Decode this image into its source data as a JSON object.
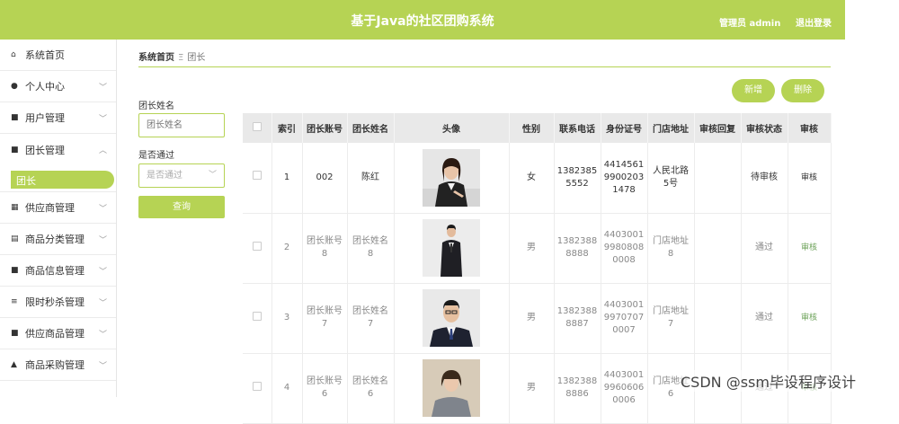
{
  "header": {
    "title": "基于Java的社区团购系统",
    "admin": "管理员 admin",
    "logout": "退出登录"
  },
  "sidebar": {
    "items": [
      {
        "label": "系统首页",
        "icon": "home-icon",
        "glyph": "▲"
      },
      {
        "label": "个人中心",
        "icon": "user-icon",
        "glyph": "●"
      },
      {
        "label": "用户管理",
        "icon": "grid-icon",
        "glyph": "■"
      },
      {
        "label": "团长管理",
        "icon": "grid-icon",
        "glyph": "■"
      },
      {
        "label": "供应商管理",
        "icon": "grid-icon",
        "glyph": "▦"
      },
      {
        "label": "商品分类管理",
        "icon": "clipboard-icon",
        "glyph": "▤"
      },
      {
        "label": "商品信息管理",
        "icon": "grid-icon",
        "glyph": "■"
      },
      {
        "label": "限时秒杀管理",
        "icon": "list-icon",
        "glyph": "≡"
      },
      {
        "label": "供应商品管理",
        "icon": "grid-icon",
        "glyph": "■"
      },
      {
        "label": "商品采购管理",
        "icon": "user-icon",
        "glyph": "▲"
      }
    ],
    "sub_active": "团长"
  },
  "breadcrumb": {
    "home": "系统首页",
    "sep": "Ξ",
    "current": "团长"
  },
  "search": {
    "name_label": "团长姓名",
    "name_placeholder": "团长姓名",
    "pass_label": "是否通过",
    "pass_value": "是否通过",
    "query_button": "查询"
  },
  "actions": {
    "add": "新增",
    "delete": "删除"
  },
  "table": {
    "headers": [
      "",
      "索引",
      "团长账号",
      "团长姓名",
      "头像",
      "性别",
      "联系电话",
      "身份证号",
      "门店地址",
      "审核回复",
      "审核状态",
      "审核"
    ],
    "rows": [
      {
        "index": "1",
        "account": "002",
        "name": "陈红",
        "gender": "女",
        "phone": "13823855552",
        "idcard": "441456199002031478",
        "address": "人民北路5号",
        "reply": "",
        "status": "待审核",
        "action": "审核"
      },
      {
        "index": "2",
        "account": "团长账号8",
        "name": "团长姓名8",
        "gender": "男",
        "phone": "13823888888",
        "idcard": "440300199808080008",
        "address": "门店地址8",
        "reply": "",
        "status": "通过",
        "action": "审核"
      },
      {
        "index": "3",
        "account": "团长账号7",
        "name": "团长姓名7",
        "gender": "男",
        "phone": "13823888887",
        "idcard": "440300199707070007",
        "address": "门店地址7",
        "reply": "",
        "status": "通过",
        "action": "审核"
      },
      {
        "index": "4",
        "account": "团长账号6",
        "name": "团长姓名6",
        "gender": "男",
        "phone": "13823888886",
        "idcard": "440300199606060006",
        "address": "门店地址6",
        "reply": "",
        "status": "通过",
        "action": "审核"
      }
    ]
  },
  "watermark": "CSDN @ssm毕设程序设计"
}
